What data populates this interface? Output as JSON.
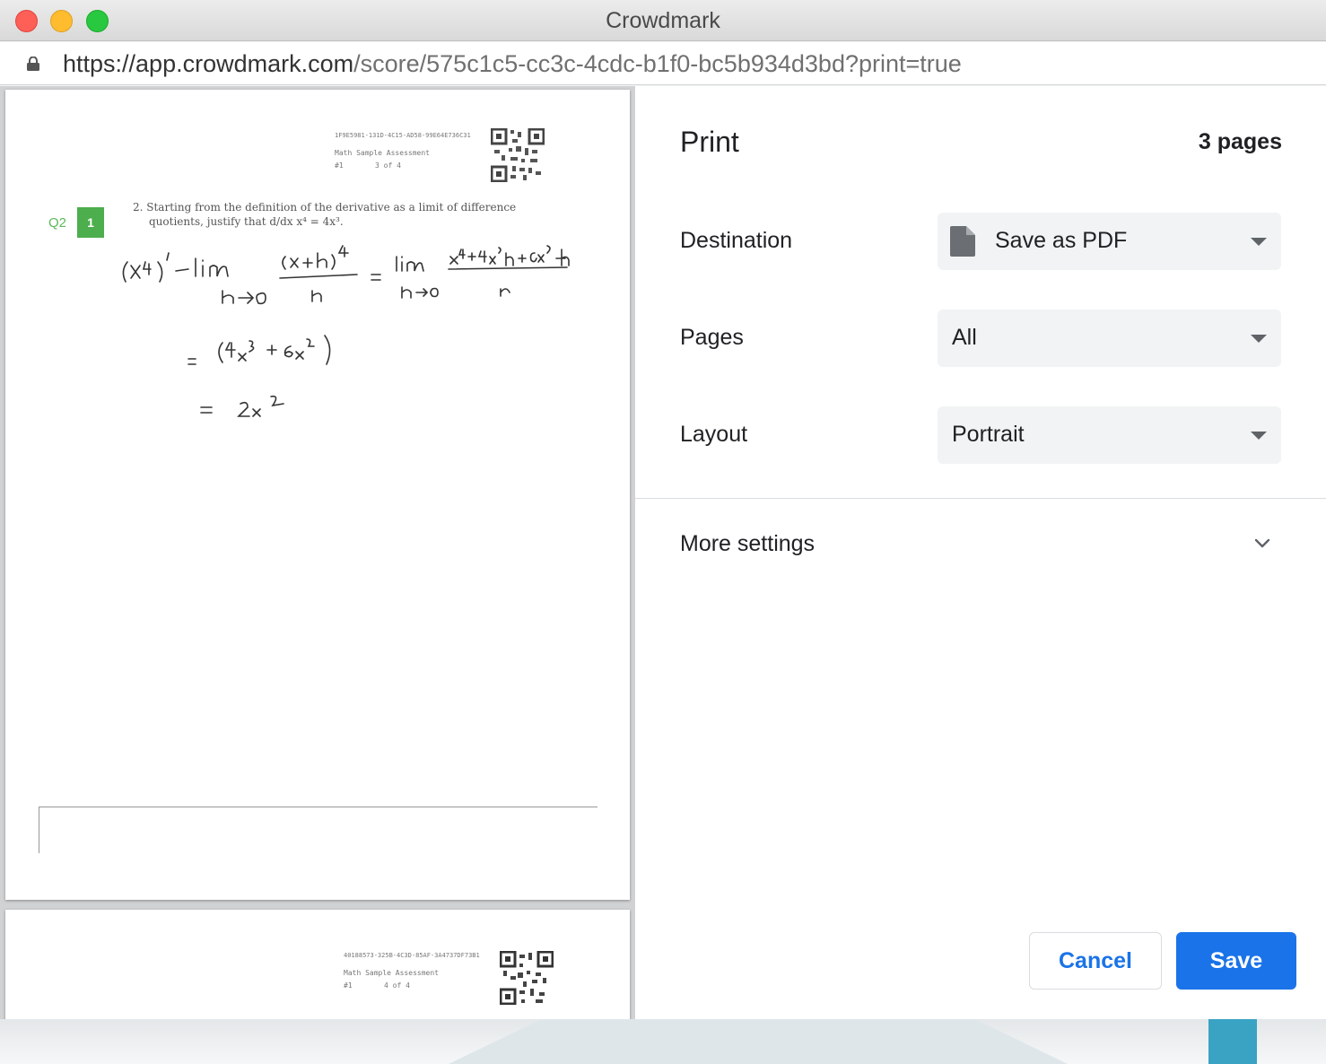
{
  "window": {
    "title": "Crowdmark",
    "url_host": "https://app.crowdmark.com",
    "url_path": "/score/575c1c5-cc3c-4cdc-b1f0-bc5b934d3bd?print=true"
  },
  "preview": {
    "page1": {
      "header_id": "1F9E5981-131D-4C15-AD58-99E64E736C31",
      "header_title": "Math Sample Assessment",
      "header_num": "#1",
      "header_page": "3 of 4",
      "question_line1": "2. Starting from the definition of the derivative as a limit of difference",
      "question_line2": "quotients, justify that d/dx x⁴ = 4x³.",
      "q_label": "Q2",
      "q_score": "1"
    },
    "page2": {
      "header_id": "40188573-325B-4C3D-85AF-3A4737DF73B1",
      "header_title": "Math Sample Assessment",
      "header_num": "#1",
      "header_page": "4 of 4"
    }
  },
  "print": {
    "title": "Print",
    "page_count": "3 pages",
    "destination": {
      "label": "Destination",
      "value": "Save as PDF"
    },
    "pages": {
      "label": "Pages",
      "value": "All"
    },
    "layout": {
      "label": "Layout",
      "value": "Portrait"
    },
    "more_settings": "More settings",
    "cancel_label": "Cancel",
    "save_label": "Save"
  },
  "colors": {
    "accent": "#1a73e8",
    "score_badge": "#4cae4c",
    "traffic_red": "#fe5f57",
    "traffic_yellow": "#febc2e",
    "traffic_green": "#28c840"
  }
}
